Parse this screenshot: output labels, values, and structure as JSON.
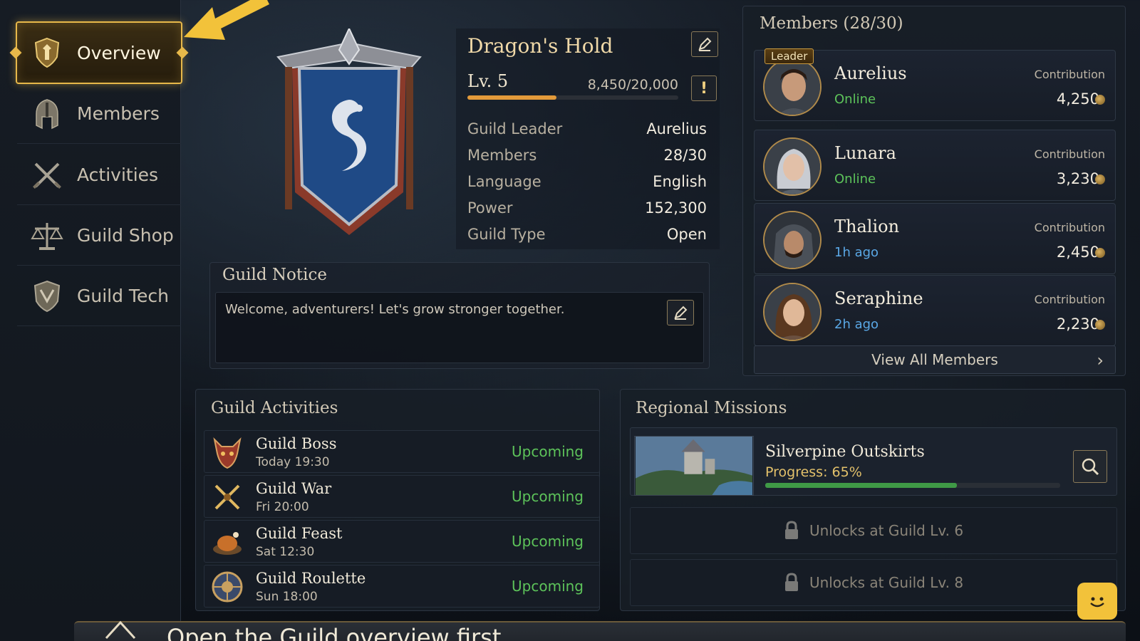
{
  "nav": {
    "items": [
      {
        "label": "Overview",
        "icon": "shield-icon",
        "active": true
      },
      {
        "label": "Members",
        "icon": "helmet-icon",
        "active": false
      },
      {
        "label": "Activities",
        "icon": "crossed-swords-icon",
        "active": false
      },
      {
        "label": "Guild Shop",
        "icon": "scales-icon",
        "active": false
      },
      {
        "label": "Guild Tech",
        "icon": "crest-icon",
        "active": false
      }
    ]
  },
  "guild": {
    "name": "Dragon's Hold",
    "level": "Lv. 5",
    "xp_text": "8,450/20,000",
    "xp_fraction": 0.4225,
    "info": [
      {
        "key": "Guild Leader",
        "value": "Aurelius"
      },
      {
        "key": "Members",
        "value": "28/30"
      },
      {
        "key": "Language",
        "value": "English"
      },
      {
        "key": "Power",
        "value": "152,300"
      },
      {
        "key": "Guild Type",
        "value": "Open"
      }
    ],
    "alert_glyph": "!"
  },
  "notice": {
    "title": "Guild Notice",
    "text": "Welcome, adventurers! Let's grow stronger together."
  },
  "members_panel": {
    "title": "Members (28/30)",
    "leader_badge": "Leader",
    "contribution_label": "Contribution",
    "members": [
      {
        "name": "Aurelius",
        "status": "Online",
        "status_color": "#5dc35a",
        "contribution": "4,250"
      },
      {
        "name": "Lunara",
        "status": "Online",
        "status_color": "#5dc35a",
        "contribution": "3,230"
      },
      {
        "name": "Thalion",
        "status": "1h ago",
        "status_color": "#5aa8e6",
        "contribution": "2,450"
      },
      {
        "name": "Seraphine",
        "status": "2h ago",
        "status_color": "#5aa8e6",
        "contribution": "2,230"
      }
    ],
    "view_all_label": "View All Members"
  },
  "activities": {
    "title": "Guild Activities",
    "items": [
      {
        "name": "Guild Boss",
        "time": "Today 19:30",
        "status": "Upcoming",
        "icon": "demon-mask-icon"
      },
      {
        "name": "Guild War",
        "time": "Fri 20:00",
        "status": "Upcoming",
        "icon": "crossed-swords-icon"
      },
      {
        "name": "Guild Feast",
        "time": "Sat 12:30",
        "status": "Upcoming",
        "icon": "roast-icon"
      },
      {
        "name": "Guild Roulette",
        "time": "Sun 18:00",
        "status": "Upcoming",
        "icon": "roulette-icon"
      }
    ]
  },
  "missions": {
    "title": "Regional Missions",
    "current": {
      "name": "Silverpine Outskirts",
      "progress_text": "Progress: 65%",
      "progress_fraction": 0.65
    },
    "locked": [
      {
        "label": "Unlocks at Guild Lv. 6"
      },
      {
        "label": "Unlocks at Guild Lv. 8"
      }
    ]
  },
  "hint": {
    "text": "Open the Guild overview first"
  },
  "colors": {
    "accent": "#e7b84a",
    "online": "#5dc35a",
    "recent": "#5aa8e6",
    "upcoming": "#5dc35a",
    "xp": "#e39a3a",
    "mission": "#3f9a46"
  }
}
